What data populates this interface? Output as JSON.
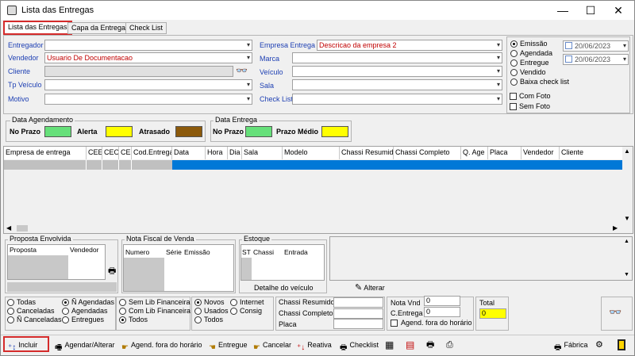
{
  "window": {
    "title": "Lista das Entregas",
    "min": "—",
    "max": "☐",
    "close": "✕"
  },
  "tabs": [
    "Lista das Entregas",
    "Capa da Entrega",
    "Check List"
  ],
  "filters_left": {
    "entregador": "Entregador",
    "vendedor": "Vendedor",
    "vendedor_value": "Usuario De Documentacao",
    "cliente": "Cliente",
    "tp_veiculo": "Tp Veículo",
    "motivo": "Motivo"
  },
  "filters_mid": {
    "empresa": "Empresa Entrega",
    "empresa_value": "Descricao da empresa 2",
    "marca": "Marca",
    "veiculo": "Veículo",
    "sala": "Sala",
    "check_list": "Check List"
  },
  "date_options": {
    "emissao": "Emissão",
    "agendada": "Agendada",
    "entregue": "Entregue",
    "vendido": "Vendido",
    "baixa": "Baixa check list",
    "date1": "20/06/2023",
    "date2": "20/06/2023",
    "com_foto": "Com Foto",
    "sem_foto": "Sem Foto"
  },
  "legend_agendamento": {
    "title": "Data Agendamento",
    "no_prazo": "No Prazo",
    "alerta": "Alerta",
    "atrasado": "Atrasado"
  },
  "legend_entrega": {
    "title": "Data Entrega",
    "no_prazo": "No Prazo",
    "prazo_medio": "Prazo Médio"
  },
  "colors": {
    "green": "#66e07a",
    "yellow": "#ffff00",
    "brown": "#8c5a0c",
    "selection": "#0078d7",
    "red_text": "#c00000",
    "blue_label": "#1d3fb3"
  },
  "grid_headers": [
    "Empresa de entrega",
    "CEE",
    "CEO",
    "CE",
    "Cod.Entrega",
    "Data",
    "Hora",
    "Dia",
    "Sala",
    "Modelo",
    "Chassi Resumido",
    "Chassi Completo",
    "Q. Age",
    "Placa",
    "Vendedor",
    "Cliente"
  ],
  "proposta": {
    "title": "Proposta Envolvida",
    "col1": "Proposta",
    "col2": "Vendedor"
  },
  "nota": {
    "title": "Nota Fiscal de Venda",
    "col1": "Numero",
    "col2": "Série",
    "col3": "Emissão"
  },
  "estoque": {
    "title": "Estoque",
    "col1": "ST",
    "col2": "Chassi",
    "col3": "Entrada",
    "detalhe": "Detalhe do veículo"
  },
  "alterar": "Alterar",
  "status_radios": {
    "todas": "Todas",
    "canceladas": "Canceladas",
    "n_canceladas": "Ñ Canceladas",
    "n_agendadas": "Ñ Agendadas",
    "agendadas": "Agendadas",
    "entregues": "Entregues"
  },
  "lib_radios": {
    "sem_lib": "Sem Lib Financeira",
    "com_lib": "Com Lib Financeira",
    "todos": "Todos"
  },
  "tipo_radios": {
    "novos": "Novos",
    "usados": "Usados",
    "todos": "Todos",
    "internet": "Internet",
    "consig": "Consig"
  },
  "chassi": {
    "resumido": "Chassi Resumido",
    "completo": "Chassi Completo",
    "placa": "Placa"
  },
  "nota_vnd": {
    "label": "Nota Vnd",
    "value": "0",
    "c_entrega": "C.Entrega",
    "c_value": "0",
    "agend_fora": "Agend. fora do horário"
  },
  "total": {
    "label": "Total",
    "value": "0"
  },
  "buttons": {
    "incluir": "Incluir",
    "agendar": "Agendar/Alterar",
    "agend_fora": "Agend. fora do horário",
    "entregue": "Entregue",
    "cancelar": "Cancelar",
    "reativa": "Reativa",
    "checklist": "Checklist",
    "fabrica": "Fábrica"
  }
}
